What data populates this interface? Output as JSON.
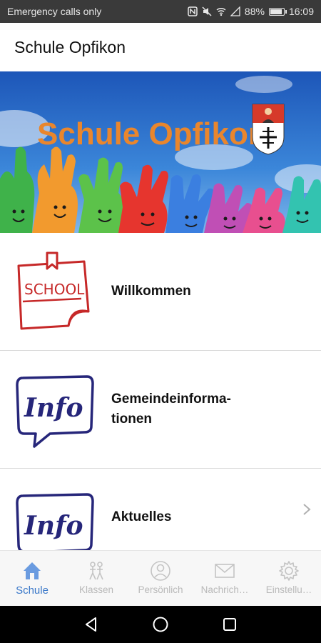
{
  "status_bar": {
    "carrier_text": "Emergency calls only",
    "battery": "88%",
    "time": "16:09"
  },
  "header": {
    "title": "Schule Opfikon"
  },
  "banner": {
    "text": "Schule Opfikon"
  },
  "menu": {
    "items": [
      {
        "label": "Willkommen",
        "icon": "school-note-icon",
        "icon_text": "SCHOOL"
      },
      {
        "label": "Gemeindeinforma-\ntionen",
        "icon": "info-bubble-icon",
        "icon_text": "Info"
      },
      {
        "label": "Aktuelles",
        "icon": "info-bubble-icon",
        "icon_text": "Info"
      }
    ]
  },
  "bottom_nav": {
    "items": [
      {
        "label": "Schule",
        "icon": "home-icon",
        "active": true
      },
      {
        "label": "Klassen",
        "icon": "children-icon",
        "active": false
      },
      {
        "label": "Persönlich",
        "icon": "person-icon",
        "active": false
      },
      {
        "label": "Nachrich…",
        "icon": "envelope-icon",
        "active": false
      },
      {
        "label": "Einstellu…",
        "icon": "gear-icon",
        "active": false
      }
    ]
  },
  "colors": {
    "status_bar_bg": "#3a3a3a",
    "active_tab": "#3a78c9",
    "inactive_tab": "#b9b9b9",
    "banner_text": "#e9862d",
    "school_red": "#c62828",
    "info_blue": "#26267a"
  }
}
